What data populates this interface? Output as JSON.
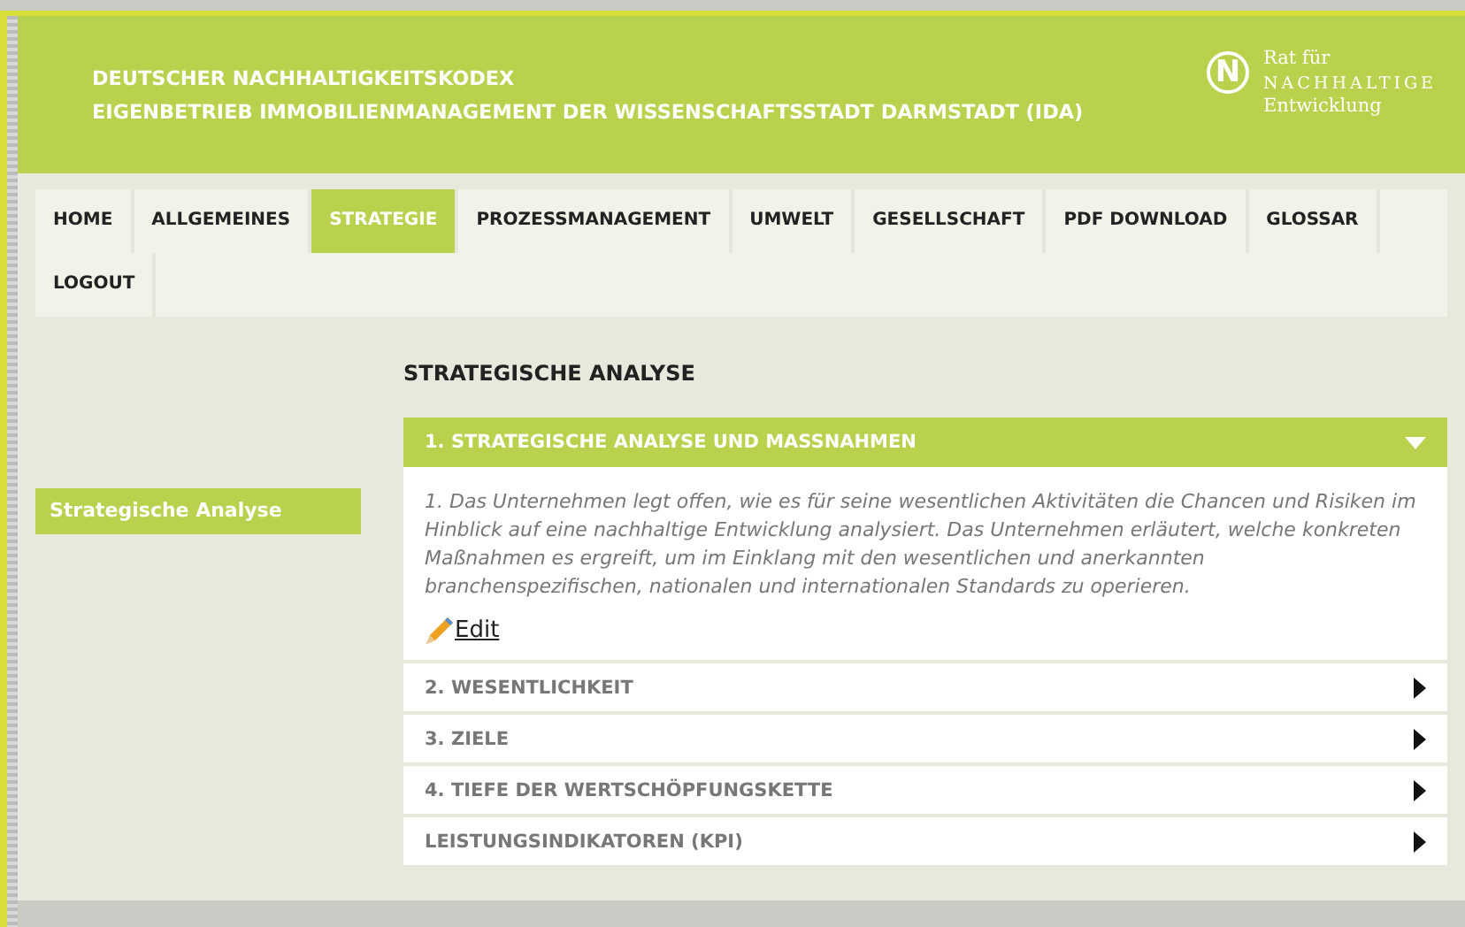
{
  "header": {
    "title_lines": [
      "DEUTSCHER NACHHALTIGKEITSKODEX",
      "EIGENBETRIEB IMMOBILIENMANAGEMENT DER WISSENSCHAFTSSTADT DARMSTADT (IDA)"
    ],
    "logo": {
      "mark": "N",
      "lines": [
        "Rat für",
        "NACHHALTIGE",
        "Entwicklung"
      ]
    }
  },
  "nav": {
    "rows": [
      [
        {
          "label": "HOME",
          "selected": false
        },
        {
          "label": "ALLGEMEINES",
          "selected": false
        },
        {
          "label": "STRATEGIE",
          "selected": true
        },
        {
          "label": "PROZESSMANAGEMENT",
          "selected": false
        },
        {
          "label": "UMWELT",
          "selected": false
        },
        {
          "label": "GESELLSCHAFT",
          "selected": false
        },
        {
          "label": "PDF DOWNLOAD",
          "selected": false
        },
        {
          "label": "GLOSSAR",
          "selected": false
        }
      ],
      [
        {
          "label": "LOGOUT",
          "selected": false
        }
      ]
    ]
  },
  "sidebar": {
    "items": [
      {
        "label": "Strategische Analyse",
        "selected": true
      }
    ]
  },
  "main": {
    "heading": "STRATEGISCHE ANALYSE",
    "sections": [
      {
        "title": "1. STRATEGISCHE ANALYSE UND MASSNAHMEN",
        "expanded": true,
        "body": "1. Das Unternehmen legt offen, wie es für seine wesentlichen Aktivitäten die Chancen und Risiken im Hinblick auf eine nachhaltige Entwicklung analysiert. Das Unternehmen erläutert, welche konkreten Maßnahmen es ergreift, um im Einklang mit den wesentlichen und anerkannten branchenspezifischen, nationalen und internationalen Standards zu operieren.",
        "edit_link": "Edit"
      },
      {
        "title": "2. WESENTLICHKEIT",
        "expanded": false
      },
      {
        "title": "3. ZIELE",
        "expanded": false
      },
      {
        "title": "4. TIEFE DER WERTSCHÖPFUNGSKETTE",
        "expanded": false
      },
      {
        "title": "LEISTUNGSINDIKATOREN (KPI)",
        "expanded": false
      }
    ]
  }
}
